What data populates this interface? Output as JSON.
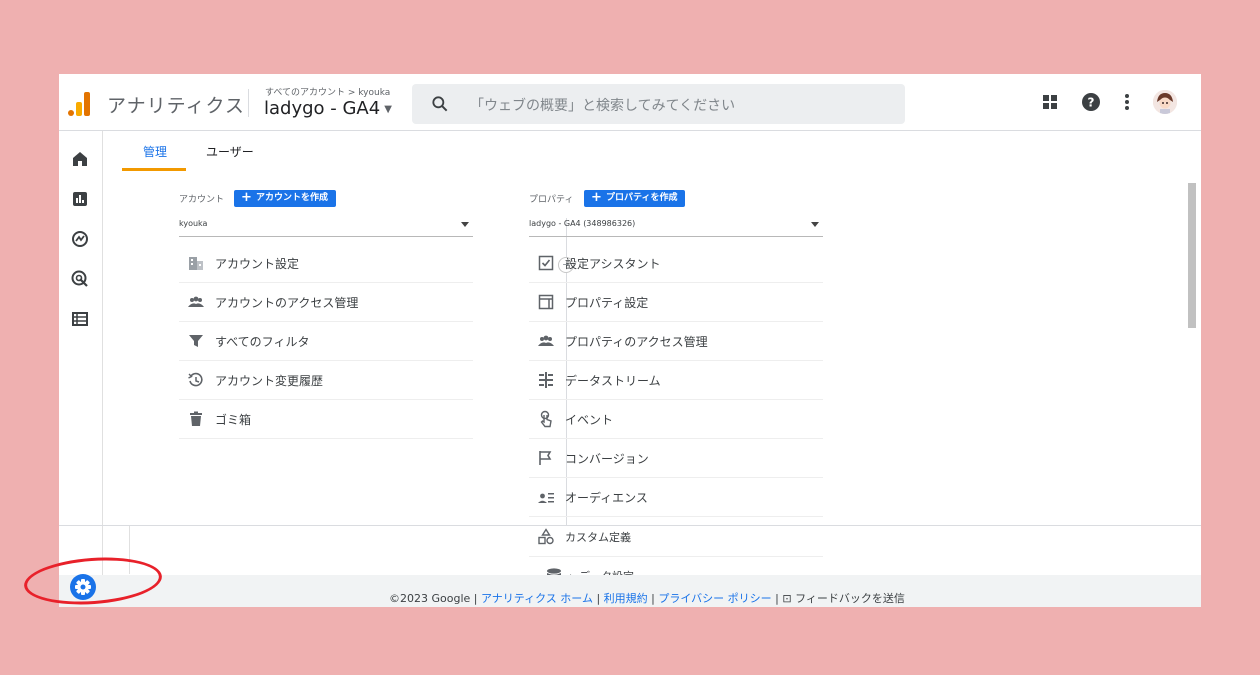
{
  "header": {
    "app_title": "アナリティクス",
    "breadcrumb": "すべてのアカウント > kyouka",
    "property_name": "ladygo - GA4",
    "search_placeholder": "「ウェブの概要」と検索してみてください"
  },
  "tabs": [
    {
      "label": "管理",
      "active": true
    },
    {
      "label": "ユーザー",
      "active": false
    }
  ],
  "account": {
    "label": "アカウント",
    "create_label": "アカウントを作成",
    "selected": "kyouka",
    "items": [
      {
        "label": "アカウント設定",
        "icon": "building-icon"
      },
      {
        "label": "アカウントのアクセス管理",
        "icon": "people-icon"
      },
      {
        "label": "すべてのフィルタ",
        "icon": "filter-icon"
      },
      {
        "label": "アカウント変更履歴",
        "icon": "history-icon"
      },
      {
        "label": "ゴミ箱",
        "icon": "trash-icon"
      }
    ]
  },
  "property": {
    "label": "プロパティ",
    "create_label": "プロパティを作成",
    "selected": "ladygo - GA4 (348986326)",
    "items": [
      {
        "label": "設定アシスタント",
        "icon": "checkbox-icon"
      },
      {
        "label": "プロパティ設定",
        "icon": "window-icon"
      },
      {
        "label": "プロパティのアクセス管理",
        "icon": "people-icon"
      },
      {
        "label": "データストリーム",
        "icon": "streams-icon"
      },
      {
        "label": "イベント",
        "icon": "touch-icon"
      },
      {
        "label": "コンバージョン",
        "icon": "flag-icon"
      },
      {
        "label": "オーディエンス",
        "icon": "audience-icon"
      },
      {
        "label": "カスタム定義",
        "icon": "shapes-icon"
      },
      {
        "label": "データ設定",
        "icon": "database-icon"
      }
    ]
  },
  "footer": {
    "copyright": "©2023 Google",
    "links": [
      "アナリティクス ホーム",
      "利用規約",
      "プライバシー ポリシー"
    ],
    "feedback": "フィードバックを送信"
  },
  "colors": {
    "accent": "#1a73e8",
    "tab_underline": "#f29900",
    "background": "#efb0b0",
    "annotation": "#e8212a"
  }
}
